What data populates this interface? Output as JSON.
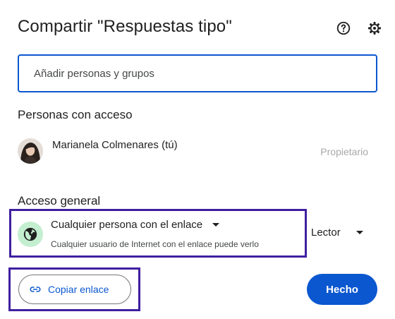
{
  "dialog": {
    "title": "Compartir \"Respuestas tipo\"",
    "icons": {
      "help": "help-circle-icon",
      "settings": "gear-icon"
    }
  },
  "add_people": {
    "placeholder": "Añadir personas y grupos",
    "value": ""
  },
  "people_with_access": {
    "heading": "Personas con acceso",
    "people": [
      {
        "name": "Marianela Colmenares (tú)",
        "role": "Propietario",
        "avatar": "user-avatar"
      }
    ]
  },
  "general_access": {
    "heading": "Acceso general",
    "option": "Cualquier persona con el enlace",
    "description": "Cualquier usuario de Internet con el enlace puede verlo",
    "icon": "globe-icon",
    "role": "Lector"
  },
  "actions": {
    "copy_link": "Copiar enlace",
    "copy_icon": "link-icon",
    "done": "Hecho"
  },
  "colors": {
    "accent": "#0b57d0",
    "globe_bg": "#c4eed0",
    "highlight_border": "#3f1fa0",
    "muted_text": "#a8a8a8"
  }
}
